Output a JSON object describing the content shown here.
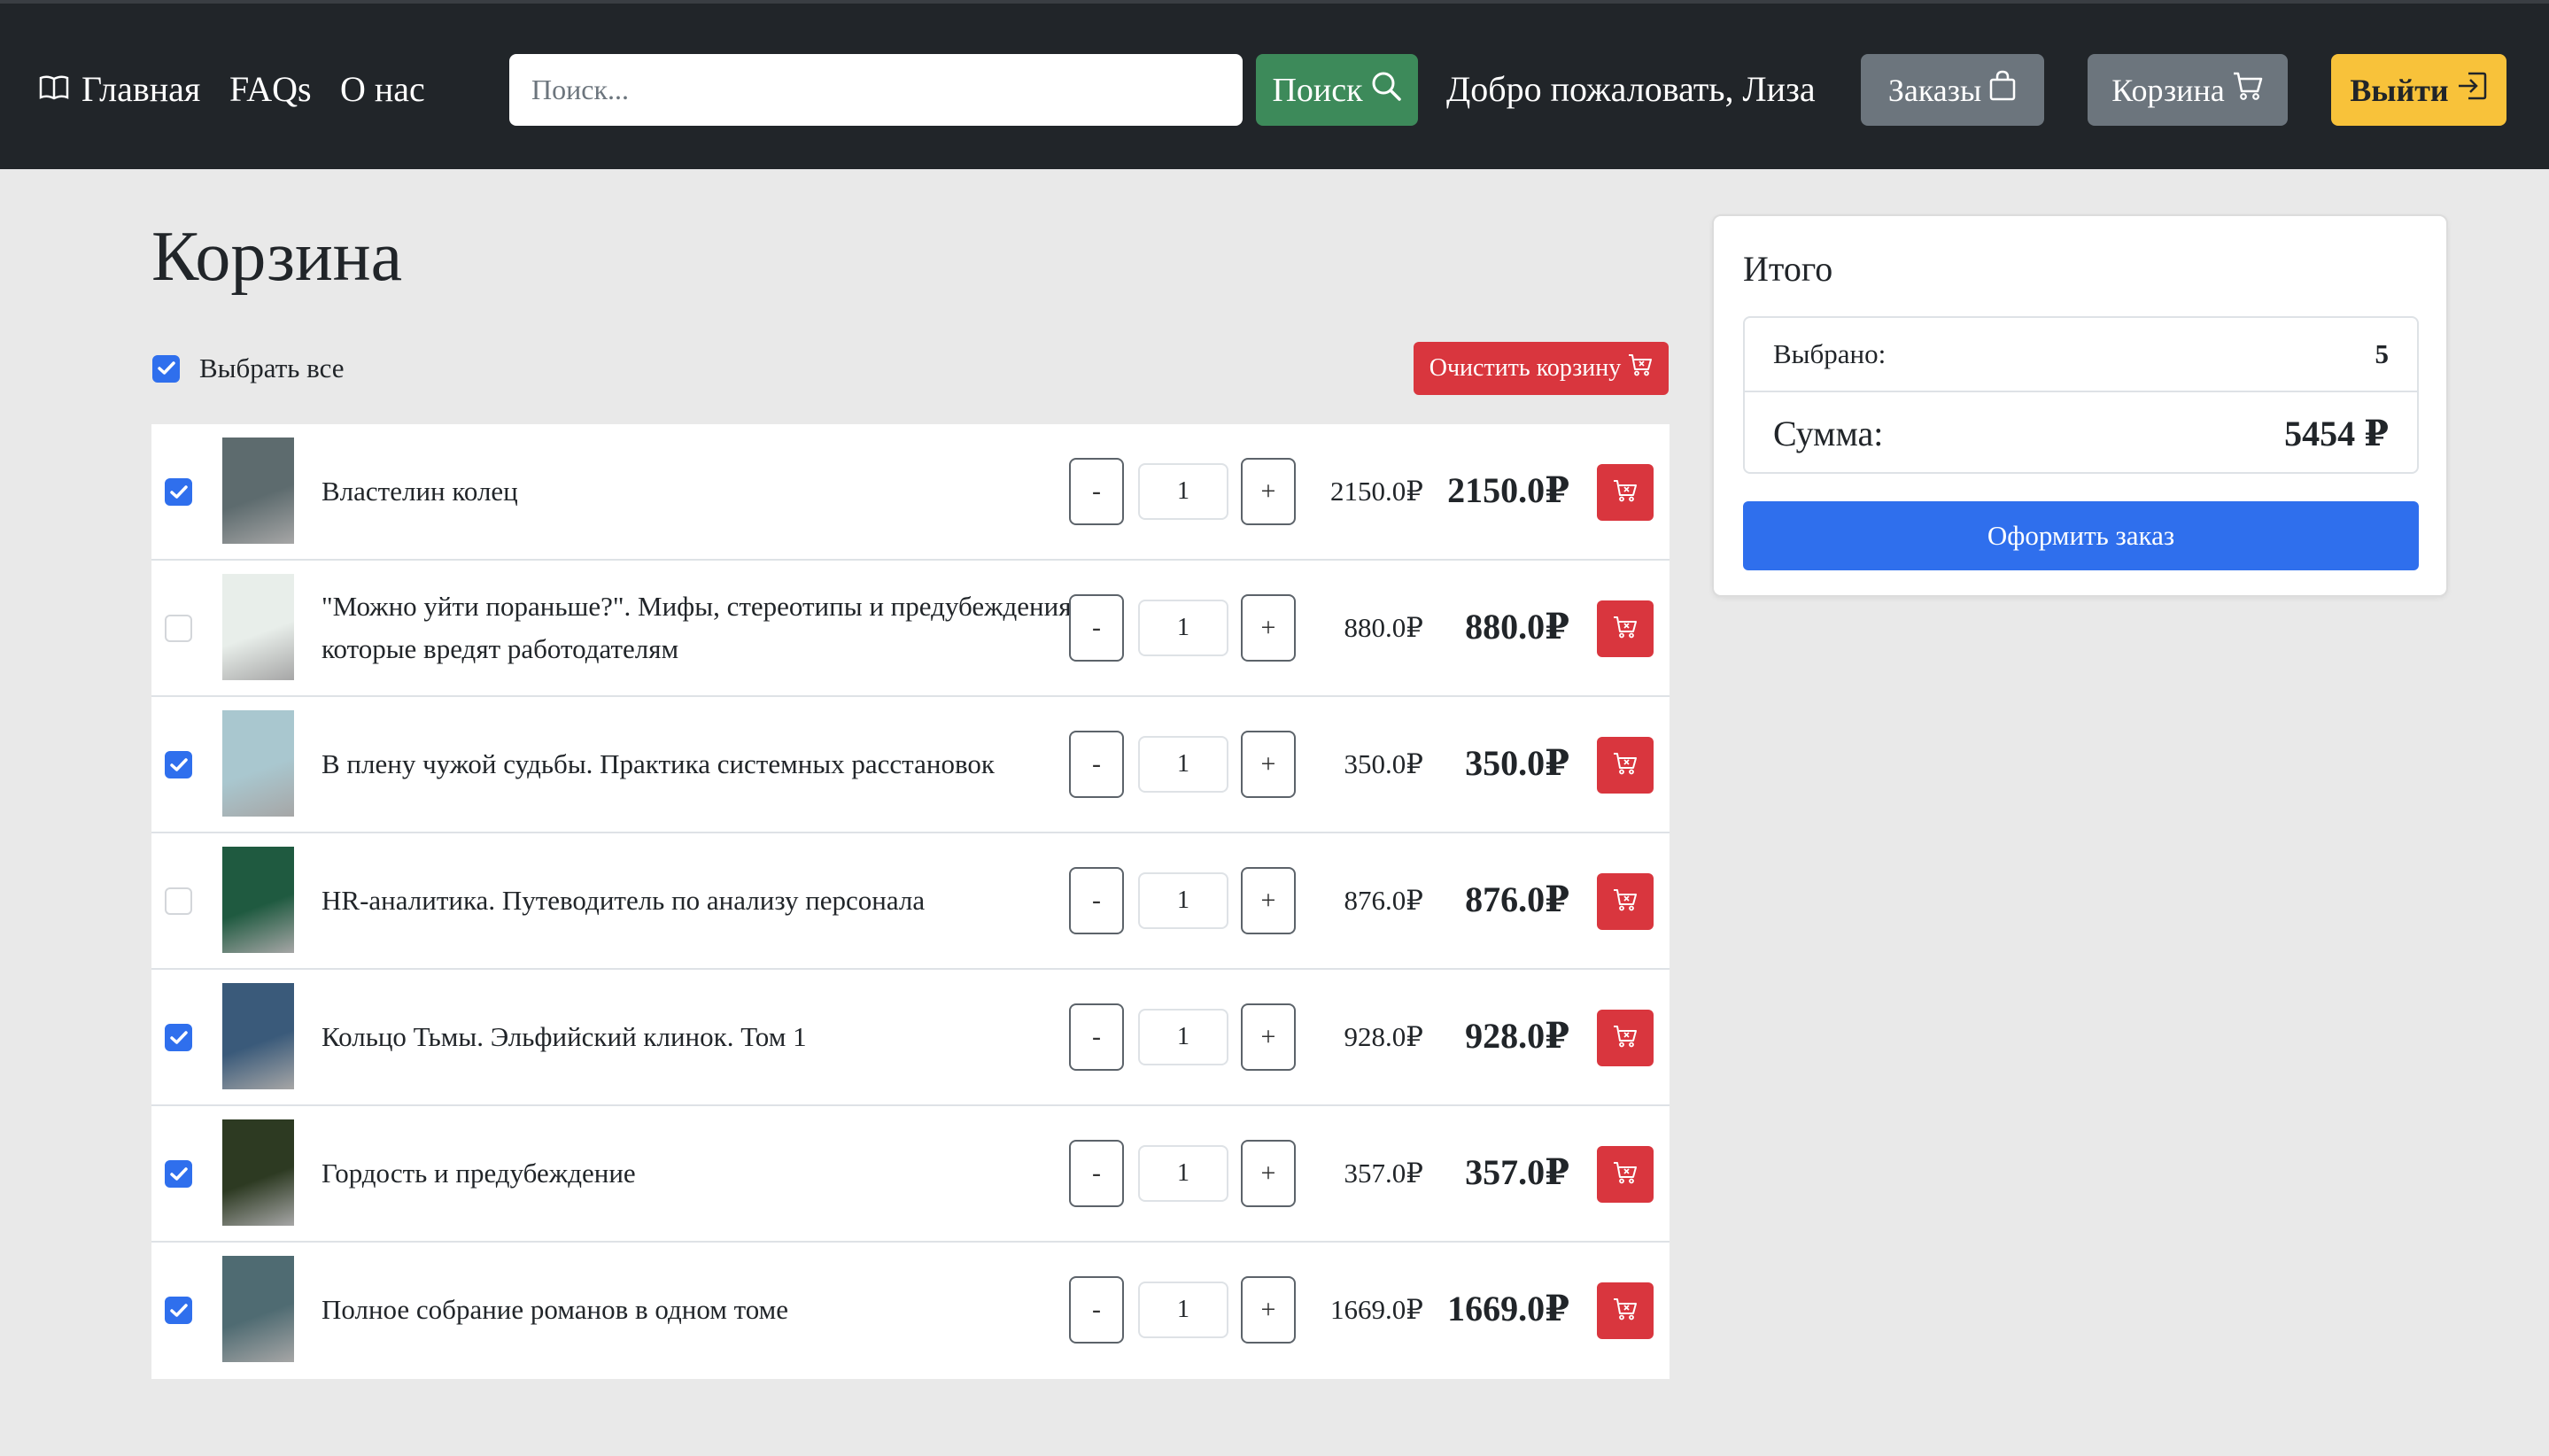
{
  "nav": {
    "home_label": "Главная",
    "faq_label": "FAQs",
    "about_label": "О нас",
    "search_placeholder": "Поиск...",
    "search_button": "Поиск",
    "welcome_text": "Добро пожаловать, Лиза",
    "orders_label": "Заказы",
    "cart_label": "Корзина",
    "logout_label": "Выйти"
  },
  "cart": {
    "title": "Корзина",
    "select_all_label": "Выбрать все",
    "select_all_checked": true,
    "clear_label": "Очистить корзину",
    "items": [
      {
        "title": "Властелин колец",
        "qty": "1",
        "unit_price": "2150.0₽",
        "total": "2150.0₽",
        "checked": true,
        "cover_color": "#5d6b6e"
      },
      {
        "title": "\"Можно уйти пораньше?\". Мифы, стереотипы и предубеждения, которые вредят работодателям",
        "qty": "1",
        "unit_price": "880.0₽",
        "total": "880.0₽",
        "checked": false,
        "cover_color": "#e8eeea"
      },
      {
        "title": "В плену чужой судьбы. Практика системных расстановок",
        "qty": "1",
        "unit_price": "350.0₽",
        "total": "350.0₽",
        "checked": true,
        "cover_color": "#a9c7cf"
      },
      {
        "title": "HR-аналитика. Путеводитель по анализу персонала",
        "qty": "1",
        "unit_price": "876.0₽",
        "total": "876.0₽",
        "checked": false,
        "cover_color": "#1f5a40"
      },
      {
        "title": "Кольцо Тьмы. Эльфийский клинок. Том 1",
        "qty": "1",
        "unit_price": "928.0₽",
        "total": "928.0₽",
        "checked": true,
        "cover_color": "#3a5a7a"
      },
      {
        "title": "Гордость и предубеждение",
        "qty": "1",
        "unit_price": "357.0₽",
        "total": "357.0₽",
        "checked": true,
        "cover_color": "#2d3a22"
      },
      {
        "title": "Полное собрание романов в одном томе",
        "qty": "1",
        "unit_price": "1669.0₽",
        "total": "1669.0₽",
        "checked": true,
        "cover_color": "#4f6b72"
      }
    ]
  },
  "summary": {
    "title": "Итого",
    "selected_label": "Выбрано:",
    "selected_value": "5",
    "sum_label": "Сумма:",
    "sum_value": "5454 ₽",
    "checkout_label": "Оформить заказ"
  },
  "colors": {
    "navbar": "#212529",
    "search_button": "#3d8a5a",
    "secondary": "#6c757d",
    "logout": "#f8c23a",
    "danger": "#d9363e",
    "primary": "#2f6fed"
  }
}
